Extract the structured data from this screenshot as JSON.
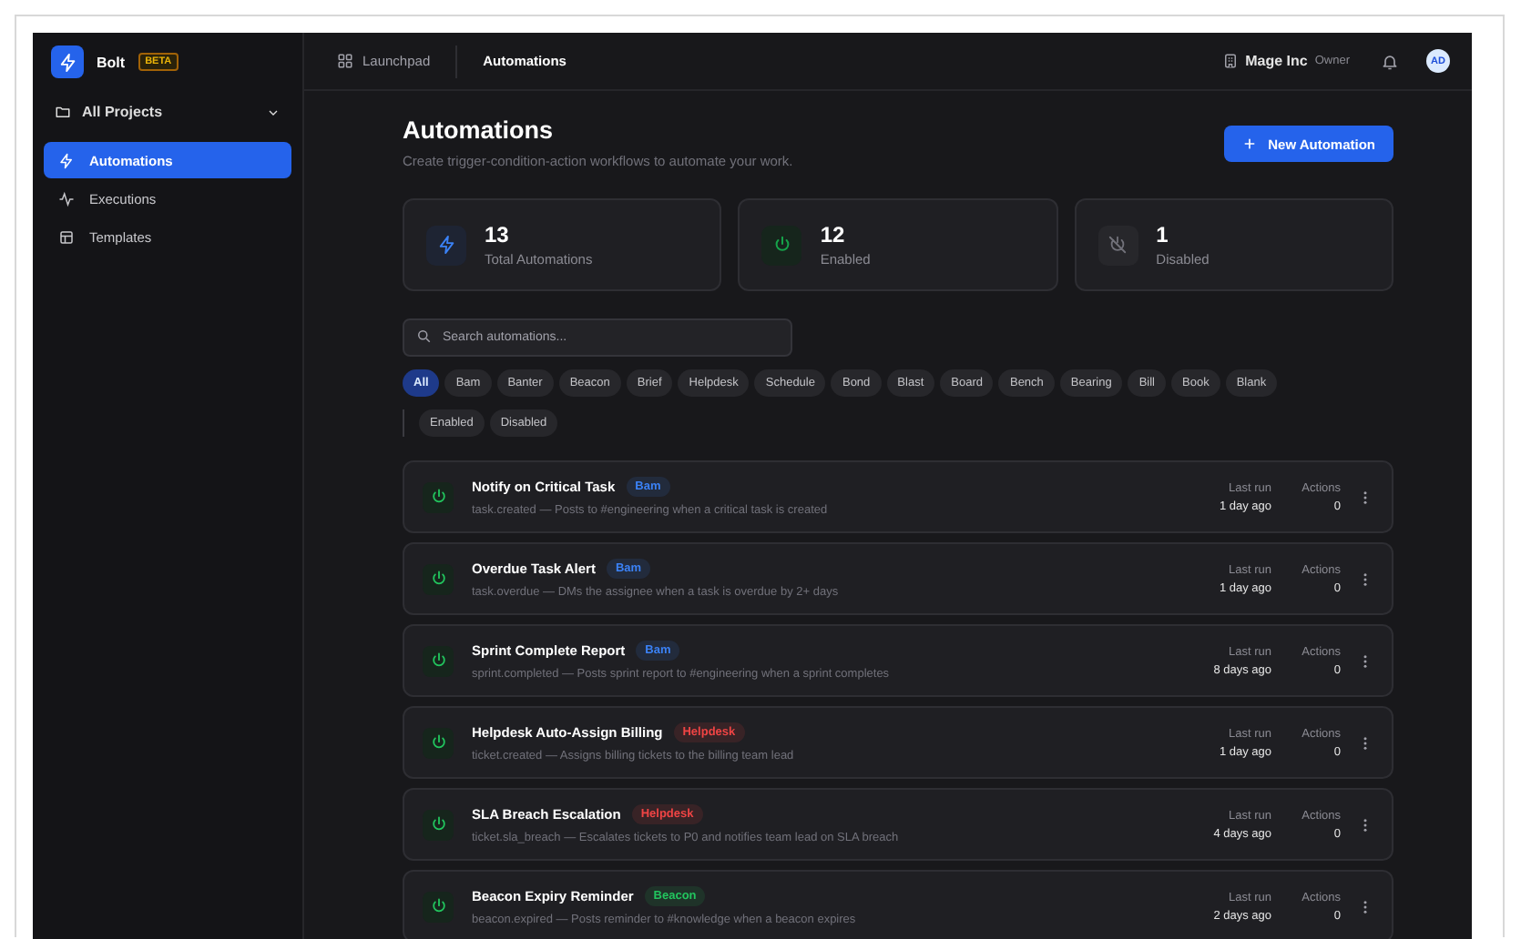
{
  "sidebar": {
    "brand": "Bolt",
    "badge": "BETA",
    "project_selector": "All Projects",
    "items": [
      {
        "label": "Automations",
        "kind": "bolt",
        "selected": true
      },
      {
        "label": "Executions",
        "kind": "pulse",
        "selected": false
      },
      {
        "label": "Templates",
        "kind": "template",
        "selected": false
      }
    ]
  },
  "topbar": {
    "breadcrumbs": [
      {
        "label": "Launchpad",
        "kind": "grid"
      },
      {
        "label": "Automations",
        "kind": "current"
      }
    ],
    "org": "Mage Inc",
    "role": "Owner",
    "avatar": "AD"
  },
  "header": {
    "title": "Automations",
    "subtitle": "Create trigger-condition-action workflows to automate your work.",
    "new_button": "New Automation"
  },
  "stats": [
    {
      "value": "13",
      "label": "Total Automations",
      "kind": "total"
    },
    {
      "value": "12",
      "label": "Enabled",
      "kind": "enabled"
    },
    {
      "value": "1",
      "label": "Disabled",
      "kind": "disabled"
    }
  ],
  "search": {
    "placeholder": "Search automations..."
  },
  "filters": {
    "apps": [
      {
        "label": "All",
        "selected": true
      },
      {
        "label": "Bam",
        "selected": false
      },
      {
        "label": "Banter",
        "selected": false
      },
      {
        "label": "Beacon",
        "selected": false
      },
      {
        "label": "Brief",
        "selected": false
      },
      {
        "label": "Helpdesk",
        "selected": false
      },
      {
        "label": "Schedule",
        "selected": false
      },
      {
        "label": "Bond",
        "selected": false
      },
      {
        "label": "Blast",
        "selected": false
      },
      {
        "label": "Board",
        "selected": false
      },
      {
        "label": "Bench",
        "selected": false
      },
      {
        "label": "Bearing",
        "selected": false
      },
      {
        "label": "Bill",
        "selected": false
      },
      {
        "label": "Book",
        "selected": false
      },
      {
        "label": "Blank",
        "selected": false
      }
    ],
    "statuses": [
      {
        "label": "Enabled",
        "selected": false
      },
      {
        "label": "Disabled",
        "selected": false
      }
    ]
  },
  "automations": [
    {
      "name": "Notify on Critical Task",
      "tag": "Bam",
      "color": "#3b82f6",
      "description": "task.created — Posts to #engineering when a critical task is created",
      "enabled": true,
      "last_run_label": "Last run",
      "last_run": "1 day ago",
      "actions_label": "Actions",
      "actions": "0"
    },
    {
      "name": "Overdue Task Alert",
      "tag": "Bam",
      "color": "#3b82f6",
      "description": "task.overdue — DMs the assignee when a task is overdue by 2+ days",
      "enabled": true,
      "last_run_label": "Last run",
      "last_run": "1 day ago",
      "actions_label": "Actions",
      "actions": "0"
    },
    {
      "name": "Sprint Complete Report",
      "tag": "Bam",
      "color": "#3b82f6",
      "description": "sprint.completed — Posts sprint report to #engineering when a sprint completes",
      "enabled": true,
      "last_run_label": "Last run",
      "last_run": "8 days ago",
      "actions_label": "Actions",
      "actions": "0"
    },
    {
      "name": "Helpdesk Auto-Assign Billing",
      "tag": "Helpdesk",
      "color": "#ef4444",
      "description": "ticket.created — Assigns billing tickets to the billing team lead",
      "enabled": true,
      "last_run_label": "Last run",
      "last_run": "1 day ago",
      "actions_label": "Actions",
      "actions": "0"
    },
    {
      "name": "SLA Breach Escalation",
      "tag": "Helpdesk",
      "color": "#ef4444",
      "description": "ticket.sla_breach — Escalates tickets to P0 and notifies team lead on SLA breach",
      "enabled": true,
      "last_run_label": "Last run",
      "last_run": "4 days ago",
      "actions_label": "Actions",
      "actions": "0"
    },
    {
      "name": "Beacon Expiry Reminder",
      "tag": "Beacon",
      "color": "#22c55e",
      "description": "beacon.expired — Posts reminder to #knowledge when a beacon expires",
      "enabled": true,
      "last_run_label": "Last run",
      "last_run": "2 days ago",
      "actions_label": "Actions",
      "actions": "0"
    }
  ]
}
